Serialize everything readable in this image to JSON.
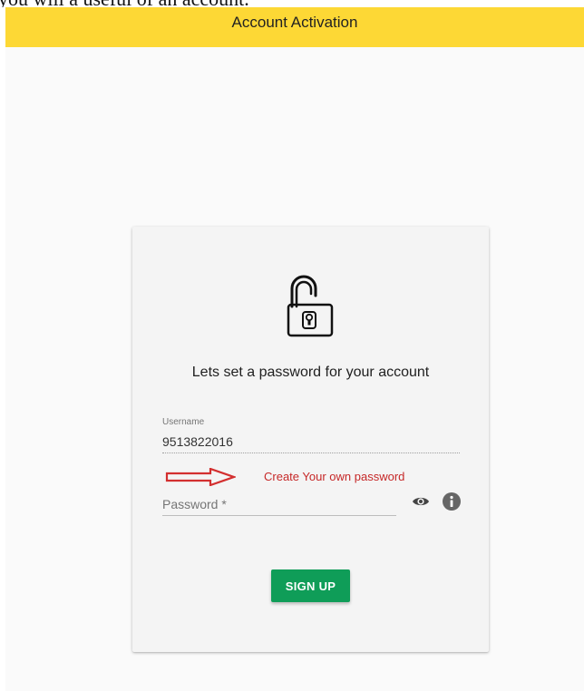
{
  "document_fragment": "you will a useful of an account.",
  "app_bar": {
    "title": "Account Activation",
    "color": "#fdd835"
  },
  "card": {
    "icon": "unlocked-padlock-icon",
    "heading": "Lets set a password for your account",
    "username": {
      "label": "Username",
      "value": "9513822016"
    },
    "password": {
      "label": "Password *",
      "value": "",
      "toggle_icon": "eye-icon",
      "help_icon": "info-icon"
    },
    "signup_button": {
      "label": "SIGN UP",
      "color": "#0f9d58"
    }
  },
  "annotation": {
    "text": "Create Your own password",
    "arrow_icon": "right-arrow-icon",
    "color": "#c62828"
  }
}
